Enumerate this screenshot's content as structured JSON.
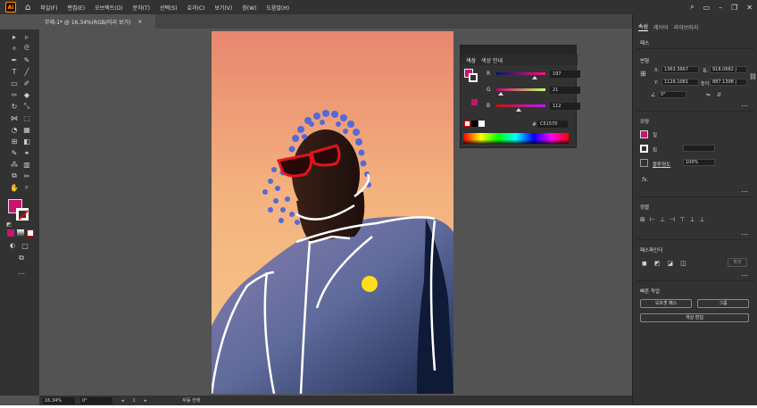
{
  "menubar": {
    "logo": "Ai",
    "items": [
      "파일(F)",
      "편집(E)",
      "오브젝트(O)",
      "문자(T)",
      "선택(S)",
      "효과(C)",
      "보기(V)",
      "창(W)",
      "도움말(H)"
    ]
  },
  "document_tab": {
    "title": "무제-1* @ 16.34%(RGB/미리 보기)",
    "close": "×"
  },
  "color_panel": {
    "tabs": [
      "색상",
      "색상 안내"
    ],
    "r": {
      "label": "R",
      "value": "197"
    },
    "g": {
      "label": "G",
      "value": "21"
    },
    "b": {
      "label": "B",
      "value": "112"
    },
    "hex_label": "#",
    "hex": "C51570"
  },
  "right_panel": {
    "tabs": [
      "속성",
      "레이어",
      "라이브러리"
    ],
    "section_path": "패스",
    "section_transform": "변형",
    "x_label": "X:",
    "x_value": "1363.3667",
    "w_label": "폭:",
    "w_value": "918.0682 j",
    "y_label": "Y:",
    "y_value": "1129.1081",
    "h_label": "높이:",
    "h_value": "887.1398 j",
    "angle_value": "0°",
    "section_appearance": "모양",
    "fill_label": "칠",
    "stroke_label": "획",
    "opacity_label": "불투명도",
    "opacity_value": "100%",
    "fx_label": "fx.",
    "section_align": "정렬",
    "section_pathfinder": "패스파인더",
    "expand_label": "확장",
    "section_quick": "빠른 작업",
    "btn_offset": "오프셋 패스",
    "btn_group": "그룹",
    "btn_recolor": "색상 편집"
  },
  "statusbar": {
    "zoom": "16.34%",
    "rotation": "0°",
    "page": "1",
    "status": "자동 선택"
  },
  "colors": {
    "fill": "#c51570",
    "highlight": "#ffde1a"
  }
}
